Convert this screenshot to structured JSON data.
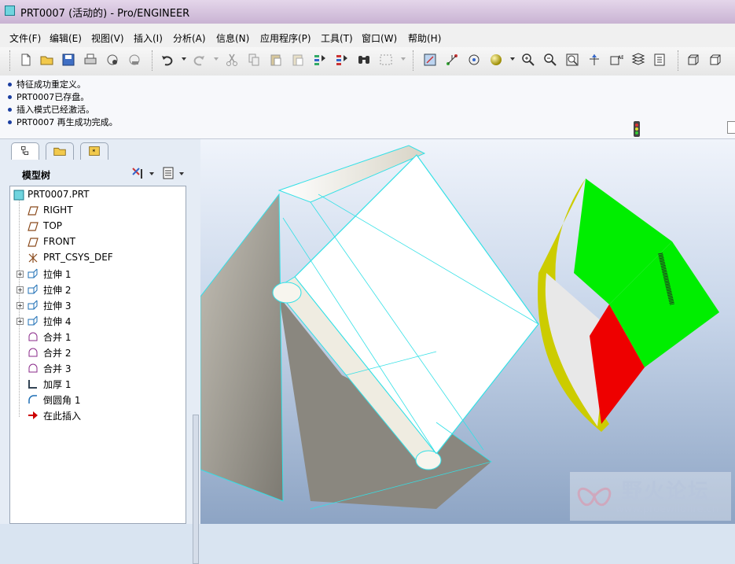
{
  "window": {
    "title": "PRT0007 (活动的) - Pro/ENGINEER"
  },
  "menu": [
    "文件(F)",
    "编辑(E)",
    "视图(V)",
    "插入(I)",
    "分析(A)",
    "信息(N)",
    "应用程序(P)",
    "工具(T)",
    "窗口(W)",
    "帮助(H)"
  ],
  "messages": [
    "特征成功重定义。",
    "PRT0007已存盘。",
    "插入模式已经激活。",
    "PRT0007 再生成功完成。"
  ],
  "panel": {
    "title": "模型树"
  },
  "tree": {
    "root": "PRT0007.PRT",
    "items": [
      {
        "label": "RIGHT",
        "icon": "datum-plane-icon",
        "expandable": false
      },
      {
        "label": "TOP",
        "icon": "datum-plane-icon",
        "expandable": false
      },
      {
        "label": "FRONT",
        "icon": "datum-plane-icon",
        "expandable": false
      },
      {
        "label": "PRT_CSYS_DEF",
        "icon": "csys-icon",
        "expandable": false
      },
      {
        "label": "拉伸 1",
        "icon": "extrude-icon",
        "expandable": true
      },
      {
        "label": "拉伸 2",
        "icon": "extrude-icon",
        "expandable": true
      },
      {
        "label": "拉伸 3",
        "icon": "extrude-icon",
        "expandable": true
      },
      {
        "label": "拉伸 4",
        "icon": "extrude-icon",
        "expandable": true
      },
      {
        "label": "合并 1",
        "icon": "merge-icon",
        "expandable": false
      },
      {
        "label": "合并 2",
        "icon": "merge-icon",
        "expandable": false
      },
      {
        "label": "合并 3",
        "icon": "merge-icon",
        "expandable": false
      },
      {
        "label": "加厚 1",
        "icon": "thicken-icon",
        "expandable": false
      },
      {
        "label": "倒圆角 1",
        "icon": "round-icon",
        "expandable": false
      },
      {
        "label": "在此插入",
        "icon": "insert-here-arrow-icon",
        "expandable": false
      }
    ]
  },
  "watermark": {
    "name": "野火论坛",
    "url": "www.proewildfire.cn"
  },
  "colors": {
    "accent_green": "#00ee00",
    "accent_red": "#ee0000",
    "accent_yellow": "#cccc00",
    "edge_cyan": "#33e0e6"
  }
}
